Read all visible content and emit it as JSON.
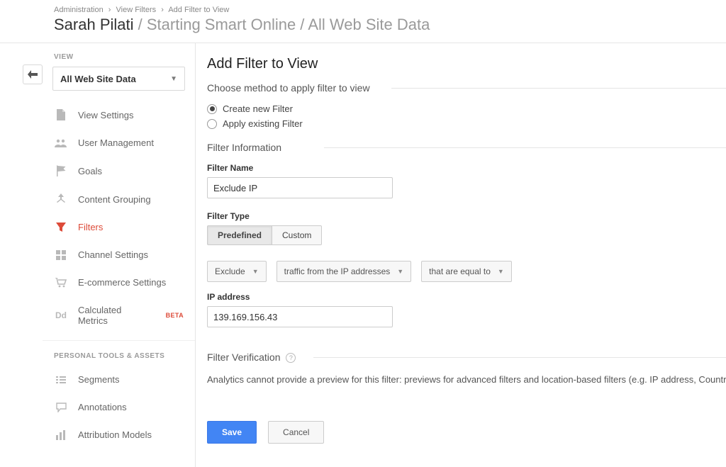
{
  "breadcrumb": {
    "item1": "Administration",
    "item2": "View Filters",
    "item3": "Add Filter to View"
  },
  "title": {
    "account": "Sarah Pilati",
    "property": "Starting Smart Online",
    "view": "All Web Site Data"
  },
  "sidebar": {
    "section_label": "VIEW",
    "view_selector_value": "All Web Site Data",
    "personal_label": "PERSONAL TOOLS & ASSETS",
    "items": [
      {
        "label": "View Settings"
      },
      {
        "label": "User Management"
      },
      {
        "label": "Goals"
      },
      {
        "label": "Content Grouping"
      },
      {
        "label": "Filters"
      },
      {
        "label": "Channel Settings"
      },
      {
        "label": "E-commerce Settings"
      },
      {
        "label": "Calculated Metrics",
        "badge": "BETA"
      }
    ],
    "personal_items": [
      {
        "label": "Segments"
      },
      {
        "label": "Annotations"
      },
      {
        "label": "Attribution Models"
      }
    ]
  },
  "page": {
    "title": "Add Filter to View",
    "method_heading": "Choose method to apply filter to view",
    "radio_create": "Create new Filter",
    "radio_apply": "Apply existing Filter",
    "filter_info_heading": "Filter Information",
    "filter_name_label": "Filter Name",
    "filter_name_value": "Exclude IP",
    "filter_type_label": "Filter Type",
    "type_predefined": "Predefined",
    "type_custom": "Custom",
    "dd_action": "Exclude",
    "dd_source": "traffic from the IP addresses",
    "dd_match": "that are equal to",
    "ip_label": "IP address",
    "ip_value": "139.169.156.43",
    "verify_heading": "Filter Verification",
    "verify_text": "Analytics cannot provide a preview for this filter: previews for advanced filters and location-based filters (e.g. IP address, Country) are",
    "save": "Save",
    "cancel": "Cancel"
  }
}
